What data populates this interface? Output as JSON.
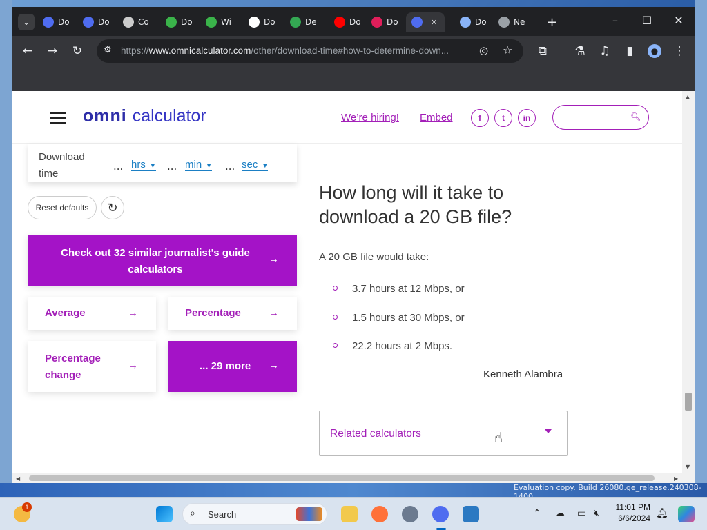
{
  "browser": {
    "tabs": [
      {
        "label": "Do",
        "icon": "chromium-icon",
        "color": "#4f6cf0"
      },
      {
        "label": "Do",
        "icon": "chromium-icon",
        "color": "#4f6cf0"
      },
      {
        "label": "Co",
        "icon": "app-icon",
        "color": "#cccccc"
      },
      {
        "label": "Do",
        "icon": "download-icon",
        "color": "#3ab34a"
      },
      {
        "label": "Wi",
        "icon": "download-icon",
        "color": "#3ab34a"
      },
      {
        "label": "Do",
        "icon": "google-icon",
        "color": "#ffffff"
      },
      {
        "label": "De",
        "icon": "drive-icon",
        "color": "#34a853"
      },
      {
        "label": "Do",
        "icon": "youtube-icon",
        "color": "#ff0000"
      },
      {
        "label": "Do",
        "icon": "slack-icon",
        "color": "#e01e5a"
      },
      {
        "label": "",
        "icon": "chromium-icon",
        "color": "#4f6cf0",
        "active": true
      },
      {
        "label": "Do",
        "icon": "download-icon",
        "color": "#8ab4f8"
      },
      {
        "label": "Ne",
        "icon": "globe-icon",
        "color": "#9aa0a6"
      }
    ],
    "new_tab": "+",
    "url_prefix": "https://",
    "url_domain": "www.omnicalculator.com",
    "url_path": "/other/download-time#how-to-determine-down..."
  },
  "header": {
    "logo_omni": "omni",
    "logo_calculator": "calculator",
    "hiring": "We’re hiring!",
    "embed": "Embed",
    "social": [
      "f",
      "t",
      "in"
    ]
  },
  "calculator": {
    "download_time_label": "Download time",
    "fields": [
      {
        "value": "...",
        "unit": "hrs"
      },
      {
        "value": "...",
        "unit": "min"
      },
      {
        "value": "...",
        "unit": "sec"
      }
    ],
    "reset": "Reset defaults"
  },
  "similar": {
    "banner": "Check out 32 similar journalist's guide calculators",
    "items": [
      "Average",
      "Percentage",
      "Percentage change",
      "... 29 more"
    ],
    "arrow": "→"
  },
  "article": {
    "heading": "How long will it take to download a 20 GB file?",
    "intro": "A 20 GB file would take:",
    "bullets": [
      "3.7 hours at 12 Mbps, or",
      "1.5 hours at 30 Mbps, or",
      "22.2 hours at 2 Mbps."
    ],
    "author": "Kenneth Alambra",
    "related": "Related calculators"
  },
  "desktop": {
    "watermark": "Evaluation copy. Build 26080.ge_release.240308-1400"
  },
  "taskbar": {
    "search_placeholder": "Search",
    "time": "11:01 PM",
    "date": "6/6/2024",
    "badge": "1"
  }
}
